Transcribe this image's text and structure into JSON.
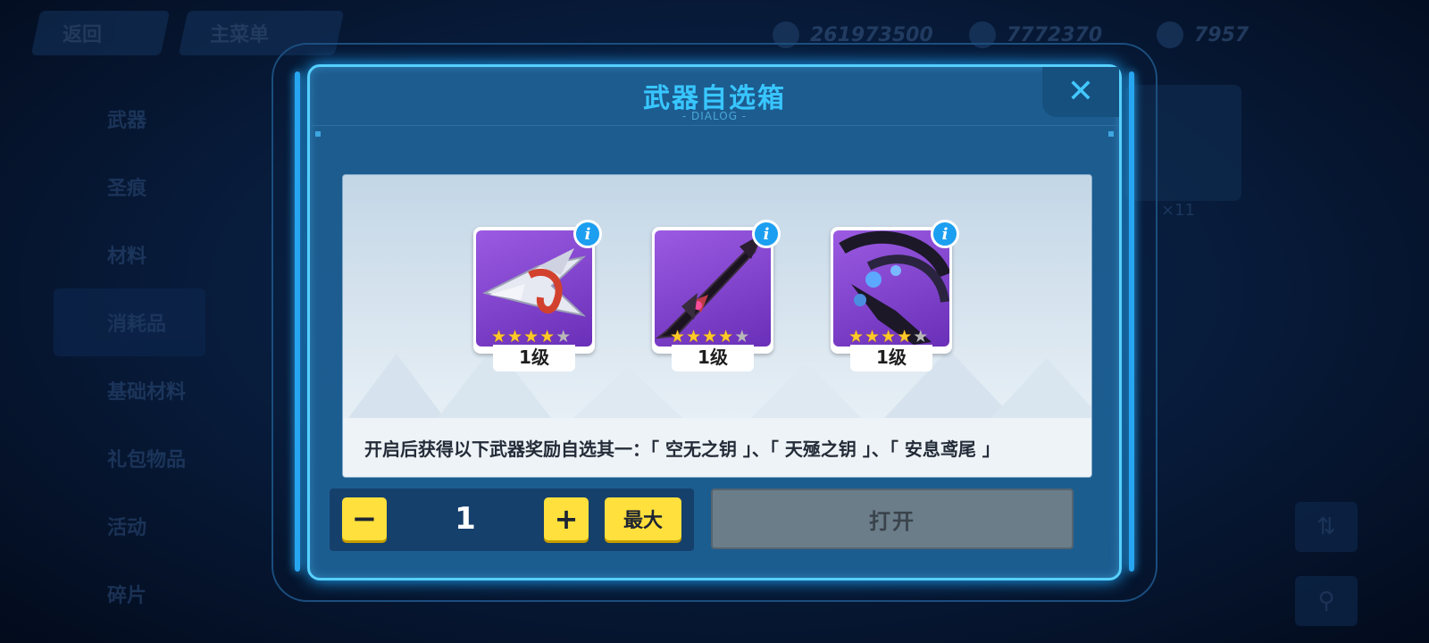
{
  "background": {
    "back_button": "返回",
    "main_menu_button": "主菜单",
    "resources": [
      {
        "icon": "stamina-icon",
        "value": "261973500"
      },
      {
        "icon": "coin-icon",
        "value": "7772370"
      },
      {
        "icon": "crystal-icon",
        "value": "7957"
      }
    ],
    "sidebar": [
      "武器",
      "圣痕",
      "材料",
      "消耗品",
      "基础材料",
      "礼包物品",
      "活动",
      "碎片"
    ],
    "right_count": "×11"
  },
  "dialog": {
    "title": "武器自选箱",
    "subtitle": "- DIALOG -",
    "close_icon": "close-icon",
    "items": [
      {
        "name": "空无之钥",
        "rarity": 4,
        "max_rarity": 5,
        "level": "1级",
        "info": "i",
        "colors": {
          "main": "#d8dbe8",
          "accent": "#d2412e"
        }
      },
      {
        "name": "天殛之钥",
        "rarity": 4,
        "max_rarity": 5,
        "level": "1级",
        "info": "i",
        "colors": {
          "main": "#1b1420",
          "accent": "#c0394a"
        }
      },
      {
        "name": "安息鸢尾",
        "rarity": 4,
        "max_rarity": 5,
        "level": "1级",
        "info": "i",
        "colors": {
          "main": "#2a2440",
          "accent": "#5da8ff"
        }
      }
    ],
    "description": "开启后获得以下武器奖励自选其一：「 空无之钥 」、「 天殛之钥 」、「 安息鸢尾 」",
    "quantity": {
      "minus_label": "−",
      "value": "1",
      "plus_label": "+",
      "max_label": "最大"
    },
    "open_label": "打开"
  },
  "colors": {
    "accent": "#38c6ff",
    "yellow_button": "#ffe03c",
    "disabled_button": "#6b7d89"
  }
}
